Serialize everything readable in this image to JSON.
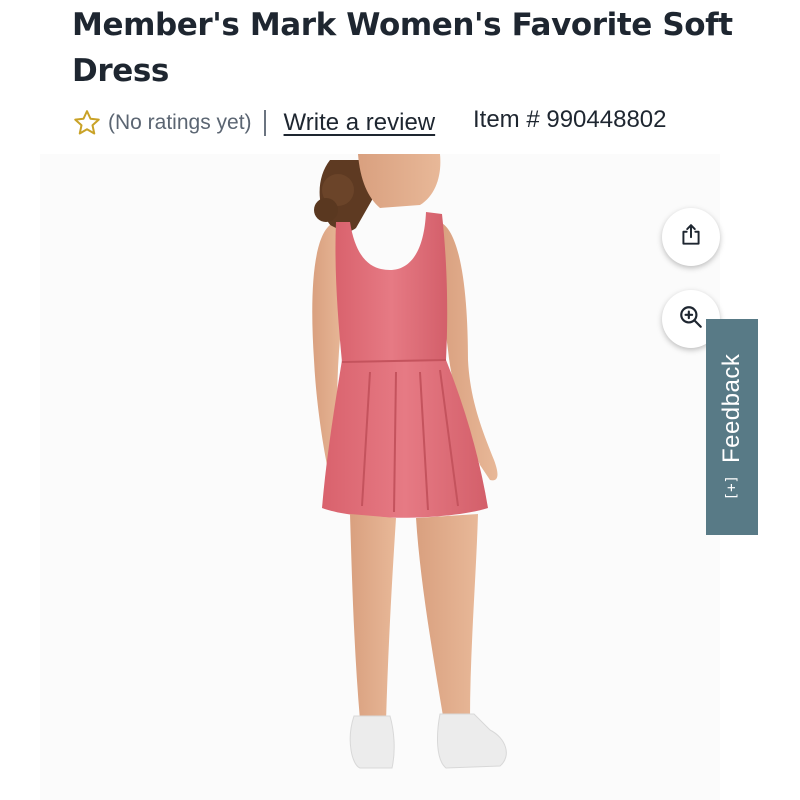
{
  "product": {
    "title": "Member's Mark Women's Favorite Soft Dress",
    "ratings_text": "(No ratings yet)",
    "write_review_label": "Write a review",
    "item_number": "Item # 990448802"
  },
  "actions": {
    "share_icon": "share-icon",
    "zoom_icon": "zoom-in-icon"
  },
  "feedback": {
    "label": "Feedback",
    "icon": "[+]"
  },
  "colors": {
    "feedback_tab": "#587a86",
    "star_outline": "#c9a227",
    "dress": "#e0717b"
  }
}
